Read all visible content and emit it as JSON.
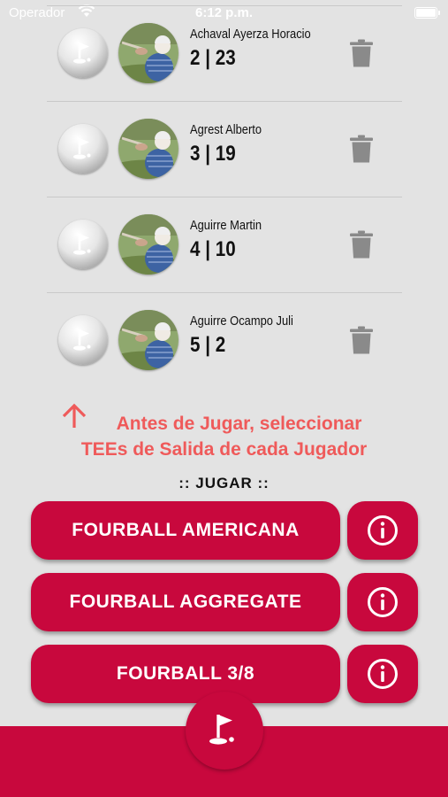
{
  "status_bar": {
    "carrier": "Operador",
    "time": "6:12 p.m."
  },
  "players": [
    {
      "name": "Achaval Ayerza Horacio",
      "score": "2 | 23"
    },
    {
      "name": "Agrest Alberto",
      "score": "3 | 19"
    },
    {
      "name": "Aguirre Martin",
      "score": "4 | 10"
    },
    {
      "name": "Aguirre Ocampo Juli",
      "score": "5 | 2"
    }
  ],
  "warning": {
    "line1": "Antes de Jugar, seleccionar",
    "line2": "TEEs de Salida de cada Jugador"
  },
  "play_heading": ":: JUGAR ::",
  "game_buttons": [
    {
      "label": "FOURBALL AMERICANA"
    },
    {
      "label": "FOURBALL AGGREGATE"
    },
    {
      "label": "FOURBALL 3/8"
    }
  ],
  "colors": {
    "accent": "#c8083d",
    "warning": "#ef5a5a",
    "background": "#e3e3e3"
  },
  "icons": {
    "tee": "golf-flag-icon",
    "delete": "trash-icon",
    "info": "info-icon",
    "fab": "golf-flag-icon",
    "warning": "arrow-up-icon"
  }
}
